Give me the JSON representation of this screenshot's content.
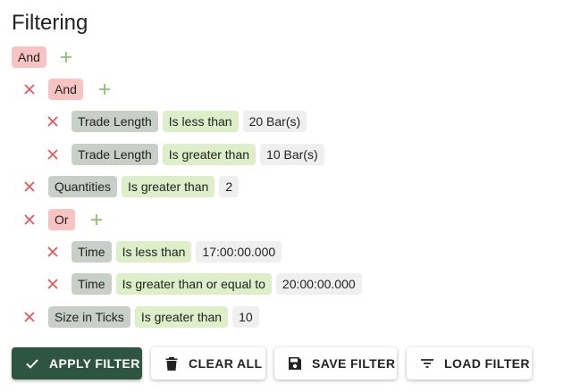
{
  "title": "Filtering",
  "root": {
    "logic": "And"
  },
  "group1": {
    "logic": "And",
    "rules": [
      {
        "field": "Trade Length",
        "operator": "Is less than",
        "value": "20 Bar(s)"
      },
      {
        "field": "Trade Length",
        "operator": "Is greater than",
        "value": "10 Bar(s)"
      }
    ]
  },
  "rule_quantities": {
    "field": "Quantities",
    "operator": "Is greater than",
    "value": "2"
  },
  "group2": {
    "logic": "Or",
    "rules": [
      {
        "field": "Time",
        "operator": "Is less than",
        "value": "17:00:00.000"
      },
      {
        "field": "Time",
        "operator": "Is greater than or equal to",
        "value": "20:00:00.000"
      }
    ]
  },
  "rule_ticks": {
    "field": "Size in Ticks",
    "operator": "Is greater than",
    "value": "10"
  },
  "buttons": {
    "apply": "APPLY FILTER",
    "clear": "CLEAR ALL",
    "save": "SAVE FILTER",
    "load": "LOAD FILTER"
  },
  "colors": {
    "logic_chip": "#f8c3c3",
    "field_chip": "#c8cfc9",
    "operator_chip": "#dcefc8",
    "value_chip": "#efefef",
    "remove_icon": "#e05a5a",
    "add_icon": "#8cc26a",
    "primary_button": "#2d5541"
  },
  "icons": {
    "remove": "close-icon",
    "add": "plus-icon",
    "apply": "check-icon",
    "clear": "trash-icon",
    "save": "floppy-disk-icon",
    "load": "filter-list-icon"
  }
}
